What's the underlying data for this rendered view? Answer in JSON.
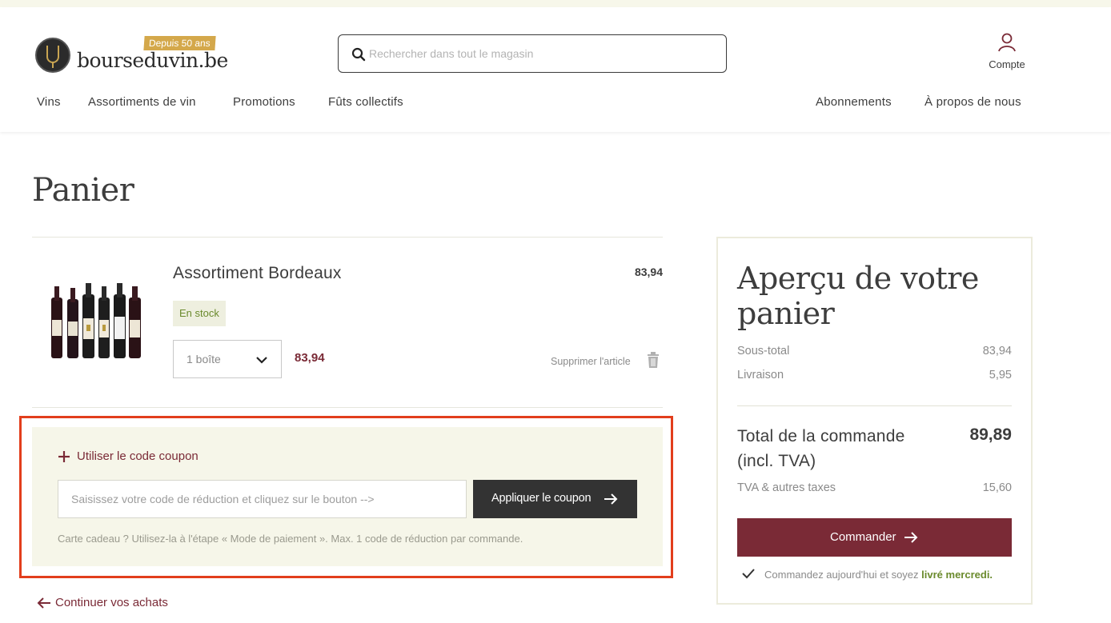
{
  "header": {
    "logo_text": "bourseduvin.be",
    "logo_badge": "Depuis 50 ans",
    "search_placeholder": "Rechercher dans tout le magasin",
    "account_label": "Compte"
  },
  "nav": {
    "left": [
      "Vins",
      "Assortiments de vin",
      "Promotions",
      "Fûts collectifs"
    ],
    "right": [
      "Abonnements",
      "À propos de nous"
    ]
  },
  "page": {
    "title": "Panier"
  },
  "cart": {
    "item": {
      "name": "Assortiment Bordeaux",
      "price": "83,94",
      "stock_status": "En stock",
      "quantity": "1 boîte",
      "line_total": "83,94",
      "remove_label": "Supprimer l'article"
    }
  },
  "coupon": {
    "toggle_label": "Utiliser le code coupon",
    "input_placeholder": "Saisissez votre code de réduction et cliquez sur le bouton -->",
    "apply_label": "Appliquer le coupon",
    "hint": "Carte cadeau ? Utilisez-la à l'étape « Mode de paiement ». Max. 1 code de réduction par commande."
  },
  "continue_label": "Continuer vos achats",
  "summary": {
    "title": "Aperçu de votre panier",
    "subtotal_label": "Sous-total",
    "subtotal_value": "83,94",
    "shipping_label": "Livraison",
    "shipping_value": "5,95",
    "total_label": "Total de la commande (incl. TVA)",
    "total_value": "89,89",
    "tax_label": "TVA & autres taxes",
    "tax_value": "15,60",
    "checkout_label": "Commander",
    "delivery_prefix": "Commandez aujourd'hui et soyez",
    "delivery_strong": "livré mercredi."
  },
  "colors": {
    "brand_wine": "#7a2a36",
    "stock_green": "#6a8a2c",
    "coupon_bg": "#f6f6e9",
    "highlight_border": "#e23e1c",
    "badge_gold": "#d4a84b"
  },
  "icons": [
    "logo-icon",
    "search-icon",
    "user-icon",
    "chevron-down-icon",
    "trash-icon",
    "plus-icon",
    "arrow-right-icon",
    "arrow-left-icon",
    "check-icon"
  ]
}
